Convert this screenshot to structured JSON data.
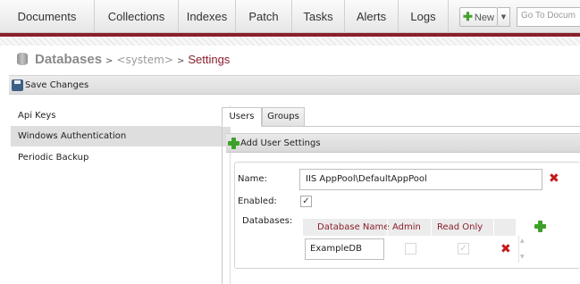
{
  "nav": {
    "items": [
      "Documents",
      "Collections",
      "Indexes",
      "Patch",
      "Tasks",
      "Alerts",
      "Logs"
    ],
    "new_label": "New",
    "goto_placeholder": "Go To Docum"
  },
  "breadcrumb": {
    "root": "Databases",
    "database": "<system>",
    "current": "Settings"
  },
  "toolbar": {
    "save_label": "Save Changes"
  },
  "menu": {
    "items": [
      "Api Keys",
      "Windows Authentication",
      "Periodic Backup"
    ],
    "active": "Windows Authentication"
  },
  "tabs": [
    "Users",
    "Groups"
  ],
  "add_settings_label": "Add User Settings",
  "user": {
    "name_label": "Name:",
    "name_value": "IIS AppPool\\DefaultAppPool",
    "enabled_label": "Enabled:",
    "enabled": true,
    "databases_label": "Databases:",
    "db_columns": [
      "Database Name",
      "Admin",
      "Read Only"
    ],
    "db_rows": [
      {
        "name": "ExampleDB",
        "admin": false,
        "read_only": true
      }
    ]
  },
  "colors": {
    "accent": "#8a1f2c",
    "add_green": "#3ea02a",
    "delete_red": "#c41a1a",
    "selected_bg": "#dedede"
  },
  "icons": [
    "database-icon",
    "save-disk-icon",
    "add-plus-icon",
    "delete-x-icon",
    "dropdown-arrow-icon",
    "checkmark-icon"
  ]
}
